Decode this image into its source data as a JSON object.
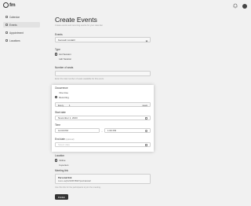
{
  "app": {
    "logo_text": "fm"
  },
  "sidebar": {
    "items": [
      {
        "label": "Calendar"
      },
      {
        "label": "Events"
      },
      {
        "label": "Appointment"
      },
      {
        "label": "Locations"
      }
    ]
  },
  "page": {
    "title": "Create Events",
    "subtitle": "Create events and recurring events for your calendar."
  },
  "form": {
    "events": {
      "label": "Events",
      "value": "Kenneth Lindahl"
    },
    "type": {
      "label": "Type",
      "options": [
        "Hot Session",
        "Lab Session"
      ],
      "selected": "Hot Session"
    },
    "number_of_seats": {
      "label": "Number of seats",
      "hint": "Enter the total number of seats available for this event."
    },
    "occurrence": {
      "label": "Occurrence",
      "options": [
        "One time",
        "Recurring"
      ],
      "selected": "Recurring",
      "every_label": "Every",
      "every_value": "1",
      "every_unit": "week"
    },
    "start_date": {
      "label": "Start date",
      "value": "November 1, 2023"
    },
    "time": {
      "label": "Time",
      "start": "12:00 PM",
      "separator": "-",
      "end": "1:00 PM"
    },
    "end_date": {
      "label": "End date",
      "optional": "(optional)",
      "placeholder": "Select date"
    },
    "location": {
      "label": "Location",
      "options": [
        "Online",
        "In-person"
      ],
      "selected": "Online"
    },
    "meeting_link": {
      "label": "Meeting link",
      "title": "Personal link",
      "id": "zoom.us/j/1234567890?pwd=abcdef"
    },
    "bottom_hint": "Use this link for the participants to join the meeting.",
    "publish_label": "Publish"
  },
  "colors": {
    "accent": "#333333",
    "panel": "#f1f1f1"
  }
}
